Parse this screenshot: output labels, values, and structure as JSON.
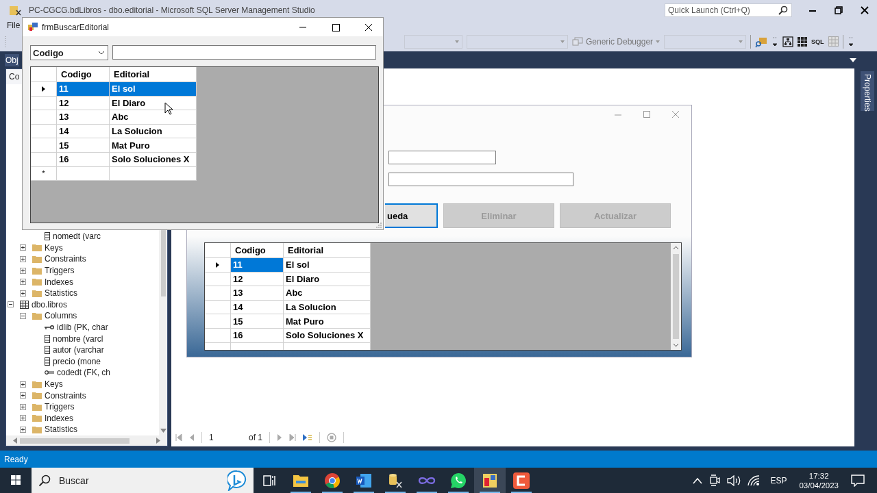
{
  "ssms": {
    "title": "PC-CGCG.bdLibros - dbo.editorial - Microsoft SQL Server Management Studio",
    "menu": [
      "File"
    ],
    "quick_launch": {
      "placeholder": "Quick Launch (Ctrl+Q)"
    },
    "toolbar": {
      "debugger": "Generic Debugger",
      "sql": "SQL"
    },
    "explorer": {
      "tab": "Obj",
      "connect": "Co",
      "tree": [
        {
          "kind": "offscreen",
          "children": [
            {
              "kind": "offscreen",
              "children": [
                {
                  "kind": "column",
                  "label": "nomedt (varc"
                }
              ]
            },
            {
              "kind": "folder",
              "label": "Keys",
              "expanded": false
            },
            {
              "kind": "folder",
              "label": "Constraints",
              "expanded": false
            },
            {
              "kind": "folder",
              "label": "Triggers",
              "expanded": false
            },
            {
              "kind": "folder",
              "label": "Indexes",
              "expanded": false
            },
            {
              "kind": "folder",
              "label": "Statistics",
              "expanded": false
            }
          ]
        },
        {
          "kind": "table",
          "label": "dbo.libros",
          "expanded": true,
          "children": [
            {
              "kind": "folder",
              "label": "Columns",
              "expanded": true,
              "children": [
                {
                  "kind": "key-column",
                  "label": "idlib (PK, char"
                },
                {
                  "kind": "column",
                  "label": "nombre (varcl"
                },
                {
                  "kind": "column",
                  "label": "autor (varchar"
                },
                {
                  "kind": "column",
                  "label": "precio (mone"
                },
                {
                  "kind": "fk-column",
                  "label": "codedt (FK, ch"
                }
              ]
            },
            {
              "kind": "folder",
              "label": "Keys",
              "expanded": false
            },
            {
              "kind": "folder",
              "label": "Constraints",
              "expanded": false
            },
            {
              "kind": "folder",
              "label": "Triggers",
              "expanded": false
            },
            {
              "kind": "folder",
              "label": "Indexes",
              "expanded": false
            },
            {
              "kind": "folder",
              "label": "Statistics",
              "expanded": false
            }
          ]
        }
      ]
    },
    "properties_tab": "Properties",
    "pager": {
      "page": "1",
      "of": "of 1"
    },
    "status": "Ready"
  },
  "back_form": {
    "fields": [
      {
        "kind": "short"
      },
      {
        "kind": "long"
      }
    ],
    "buttons": [
      {
        "label": "ueda",
        "disabled": false,
        "focused": true
      },
      {
        "label": "Eliminar",
        "disabled": true,
        "focused": false
      },
      {
        "label": "Actualizar",
        "disabled": true,
        "focused": false
      }
    ],
    "grid": {
      "vertical_scrollbar": true,
      "columns": [
        "Codigo",
        "Editorial"
      ],
      "rows": [
        {
          "cells": [
            {
              "text": "11",
              "selected": true
            },
            {
              "text": "El sol",
              "selected": false
            }
          ],
          "current": true
        },
        {
          "cells": [
            {
              "text": "12",
              "selected": false
            },
            {
              "text": "El Diaro",
              "selected": false
            }
          ],
          "current": false
        },
        {
          "cells": [
            {
              "text": "13",
              "selected": false
            },
            {
              "text": "Abc",
              "selected": false
            }
          ],
          "current": false
        },
        {
          "cells": [
            {
              "text": "14",
              "selected": false
            },
            {
              "text": "La Solucion",
              "selected": false
            }
          ],
          "current": false
        },
        {
          "cells": [
            {
              "text": "15",
              "selected": false
            },
            {
              "text": "Mat Puro",
              "selected": false
            }
          ],
          "current": false
        },
        {
          "cells": [
            {
              "text": "16",
              "selected": false
            },
            {
              "text": "Solo Soluciones X",
              "selected": false
            }
          ],
          "current": false
        }
      ]
    }
  },
  "search_form": {
    "title": "frmBuscarEditorial",
    "filter": "Codigo",
    "grid": {
      "vertical_scrollbar": false,
      "new_row_marker": "*",
      "columns": [
        "Codigo",
        "Editorial"
      ],
      "rows": [
        {
          "cells": [
            {
              "text": "11",
              "selected": true
            },
            {
              "text": "El sol",
              "selected": true
            }
          ],
          "current": true
        },
        {
          "cells": [
            {
              "text": "12",
              "selected": false
            },
            {
              "text": "El Diaro",
              "selected": false
            }
          ],
          "current": false
        },
        {
          "cells": [
            {
              "text": "13",
              "selected": false
            },
            {
              "text": "Abc",
              "selected": false
            }
          ],
          "current": false
        },
        {
          "cells": [
            {
              "text": "14",
              "selected": false
            },
            {
              "text": "La Solucion",
              "selected": false
            }
          ],
          "current": false
        },
        {
          "cells": [
            {
              "text": "15",
              "selected": false
            },
            {
              "text": "Mat Puro",
              "selected": false
            }
          ],
          "current": false
        },
        {
          "cells": [
            {
              "text": "16",
              "selected": false
            },
            {
              "text": "Solo Soluciones X",
              "selected": false
            }
          ],
          "current": false
        }
      ]
    }
  },
  "taskbar": {
    "search_placeholder": "Buscar",
    "apps": [
      {
        "kind": "task-view",
        "running": false,
        "active": false
      },
      {
        "kind": "folder",
        "running": true,
        "active": false
      },
      {
        "kind": "chrome",
        "running": true,
        "active": false
      },
      {
        "kind": "word",
        "running": true,
        "active": false
      },
      {
        "kind": "database",
        "running": true,
        "active": false
      },
      {
        "kind": "loop",
        "running": true,
        "active": false
      },
      {
        "kind": "whatsapp",
        "running": true,
        "active": false
      },
      {
        "kind": "form-app",
        "running": true,
        "active": true
      },
      {
        "kind": "c-app",
        "running": true,
        "active": false
      }
    ],
    "language": "ESP",
    "time": "17:32",
    "date": "03/04/2023"
  }
}
